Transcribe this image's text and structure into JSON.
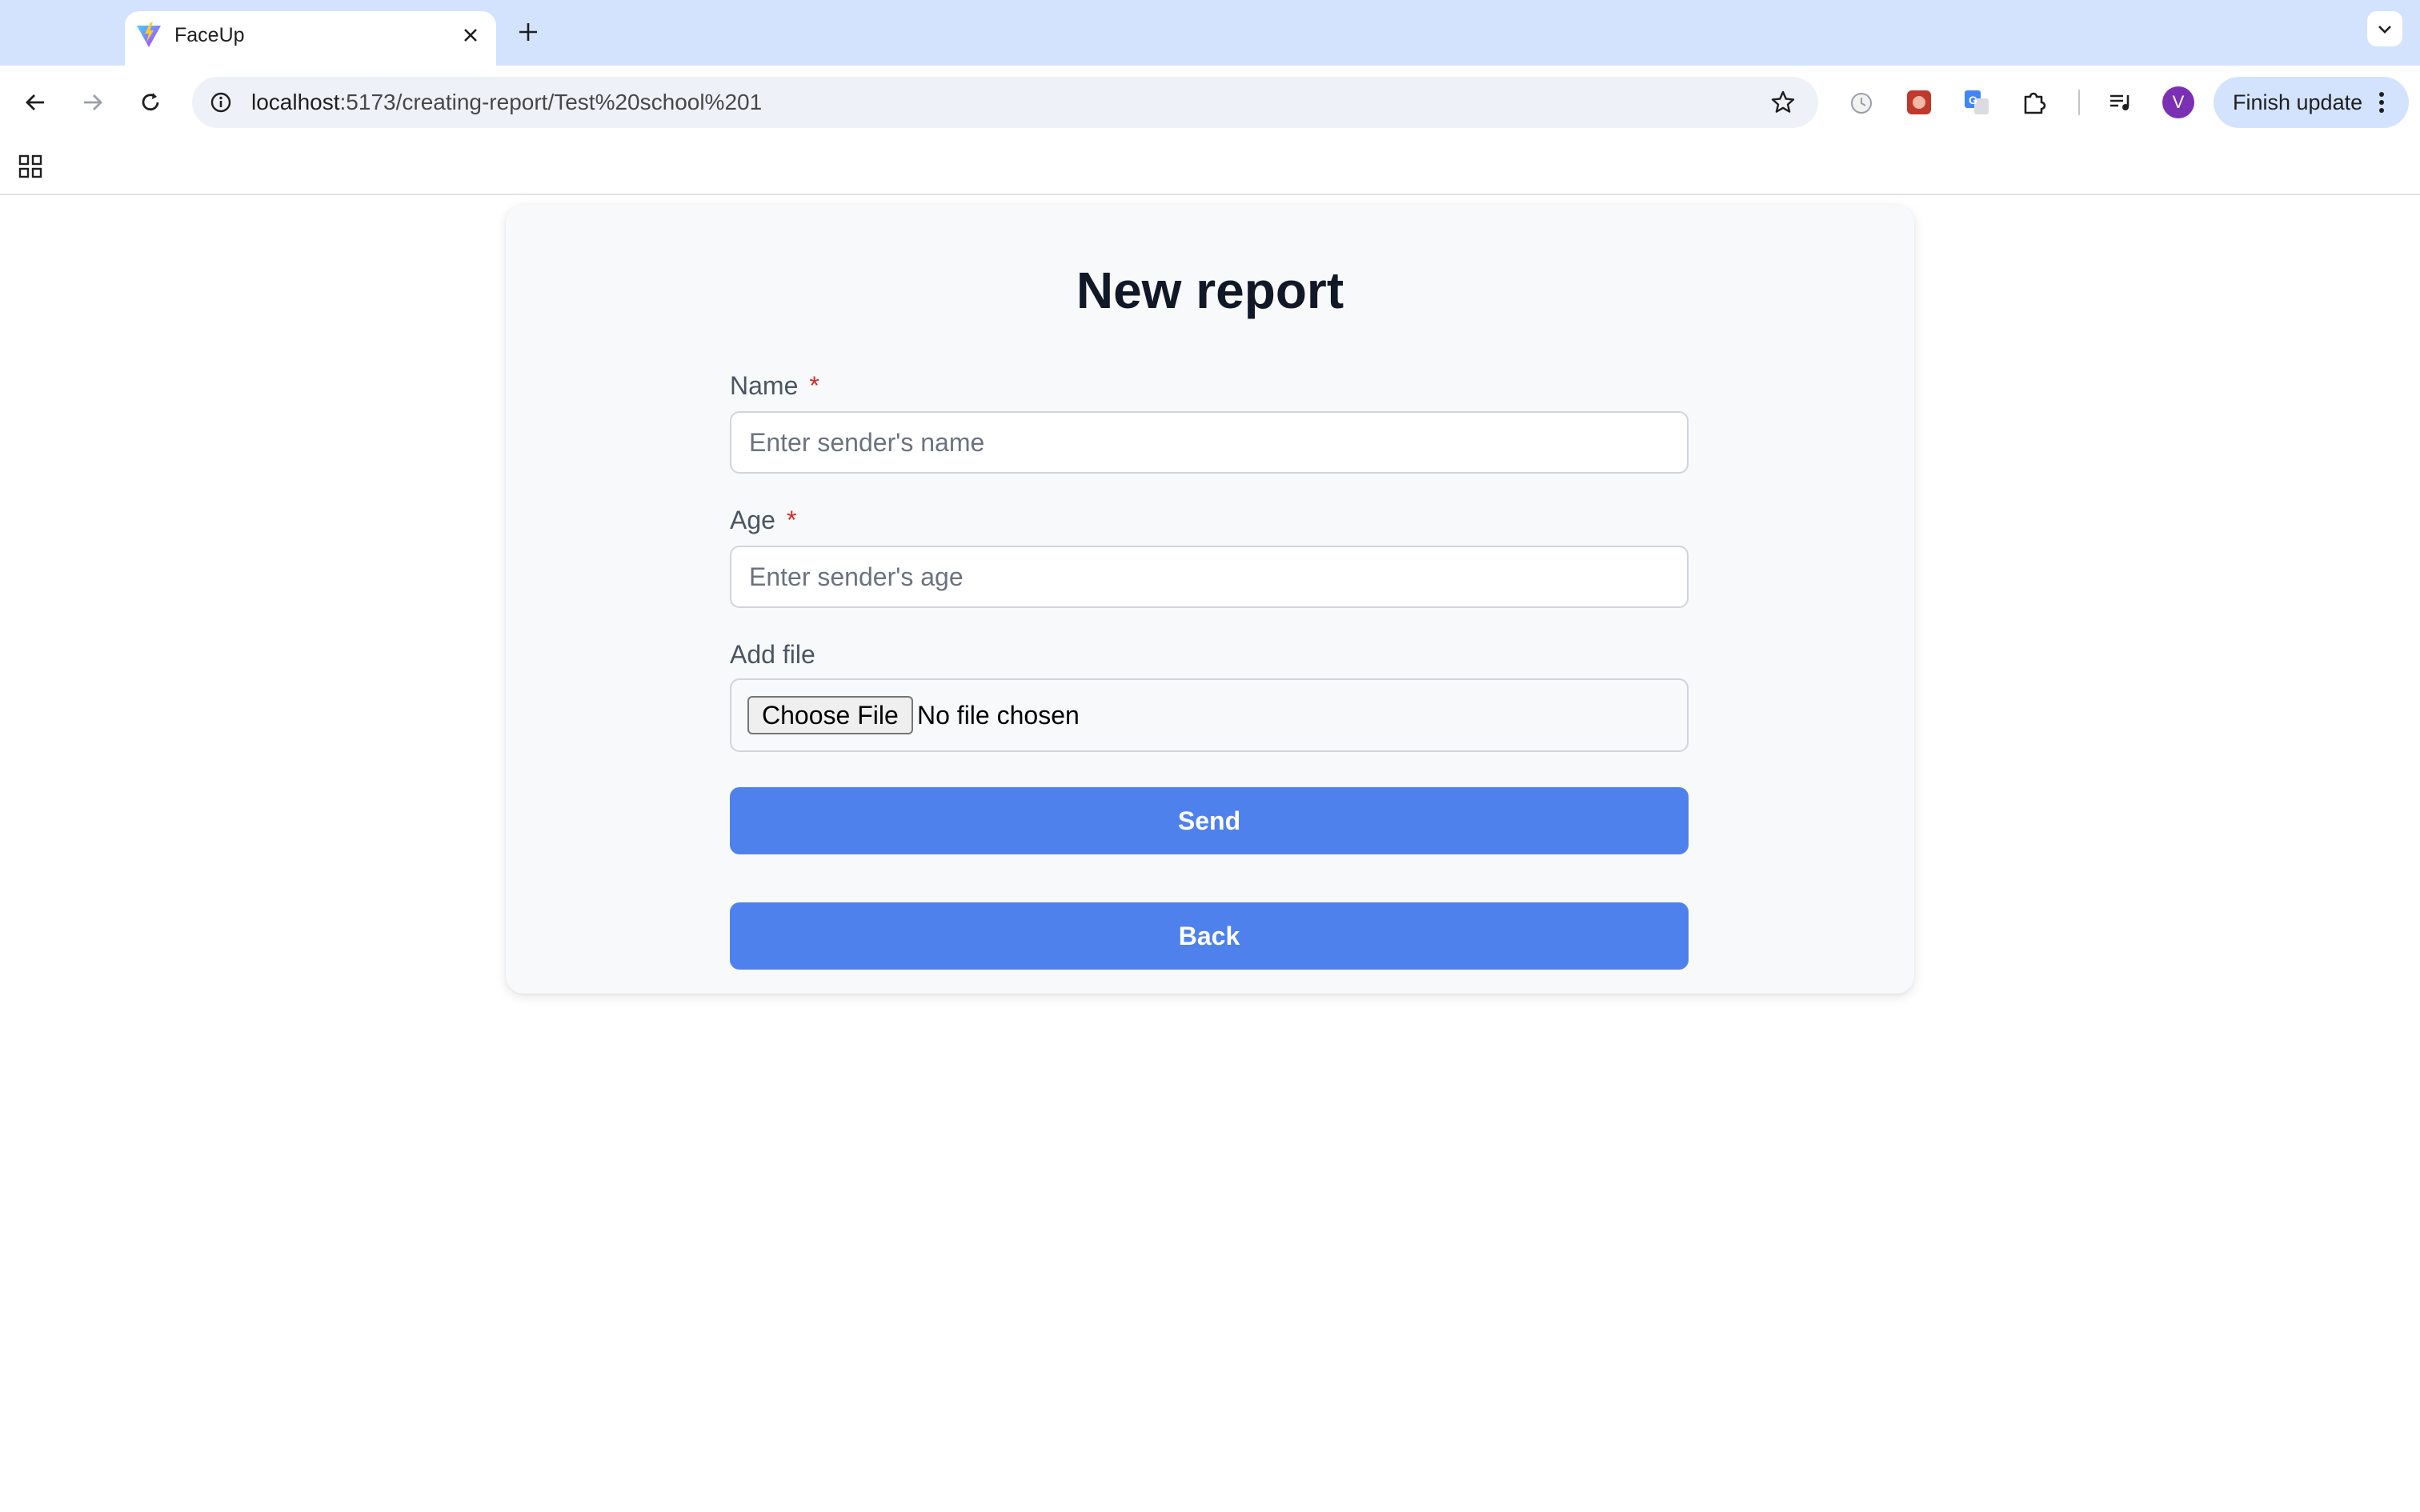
{
  "browser": {
    "tab": {
      "title": "FaceUp"
    },
    "url": {
      "host": "localhost",
      "path": ":5173/creating-report/Test%20school%201"
    },
    "profile_initial": "V",
    "update_button": "Finish update",
    "colors": {
      "tabstrip": "#d3e3fd",
      "omnibox": "#eef2f8",
      "avatar": "#7b2fb3"
    }
  },
  "form": {
    "title": "New report",
    "name": {
      "label": "Name",
      "required_mark": "*",
      "placeholder": "Enter sender's name",
      "value": ""
    },
    "age": {
      "label": "Age",
      "required_mark": "*",
      "placeholder": "Enter sender's age",
      "value": ""
    },
    "file": {
      "label": "Add file",
      "button": "Choose File",
      "status": "No file chosen"
    },
    "send_button": "Send",
    "back_button": "Back",
    "colors": {
      "primary": "#4f81ec",
      "required": "#dc2626",
      "card_bg": "#f8f9fa"
    }
  }
}
